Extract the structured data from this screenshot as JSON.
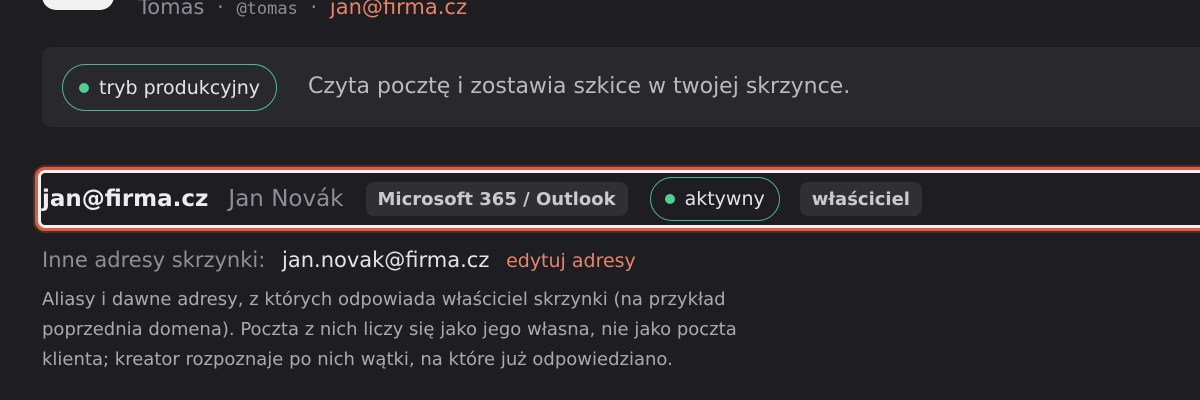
{
  "header": {
    "name": "Tomas",
    "separator": "·",
    "handle": "@tomas",
    "email": "jan@firma.cz"
  },
  "mode_banner": {
    "pill_label": "tryb produkcyjny",
    "description": "Czyta pocztę i zostawia szkice w twojej skrzynce."
  },
  "mailbox": {
    "email": "jan@firma.cz",
    "owner_name": "Jan Novák",
    "provider": "Microsoft 365 / Outlook",
    "status": "aktywny",
    "role": "właściciel"
  },
  "other_addresses": {
    "label": "Inne adresy skrzynki:",
    "value": "jan.novak@firma.cz",
    "edit_label": "edytuj adresy"
  },
  "help_text": "Aliasy i dawne adresy, z których odpowiada właściciel skrzynki (na przykład poprzednia domena). Poczta z nich liczy się jako jego własna, nie jako poczta klienta; kreator rozpoznaje po nich wątki, na które już odpowiedziano.",
  "colors": {
    "accent": "#e8836a",
    "status_green": "#4fcf92",
    "highlight_border": "#e35b3e"
  }
}
